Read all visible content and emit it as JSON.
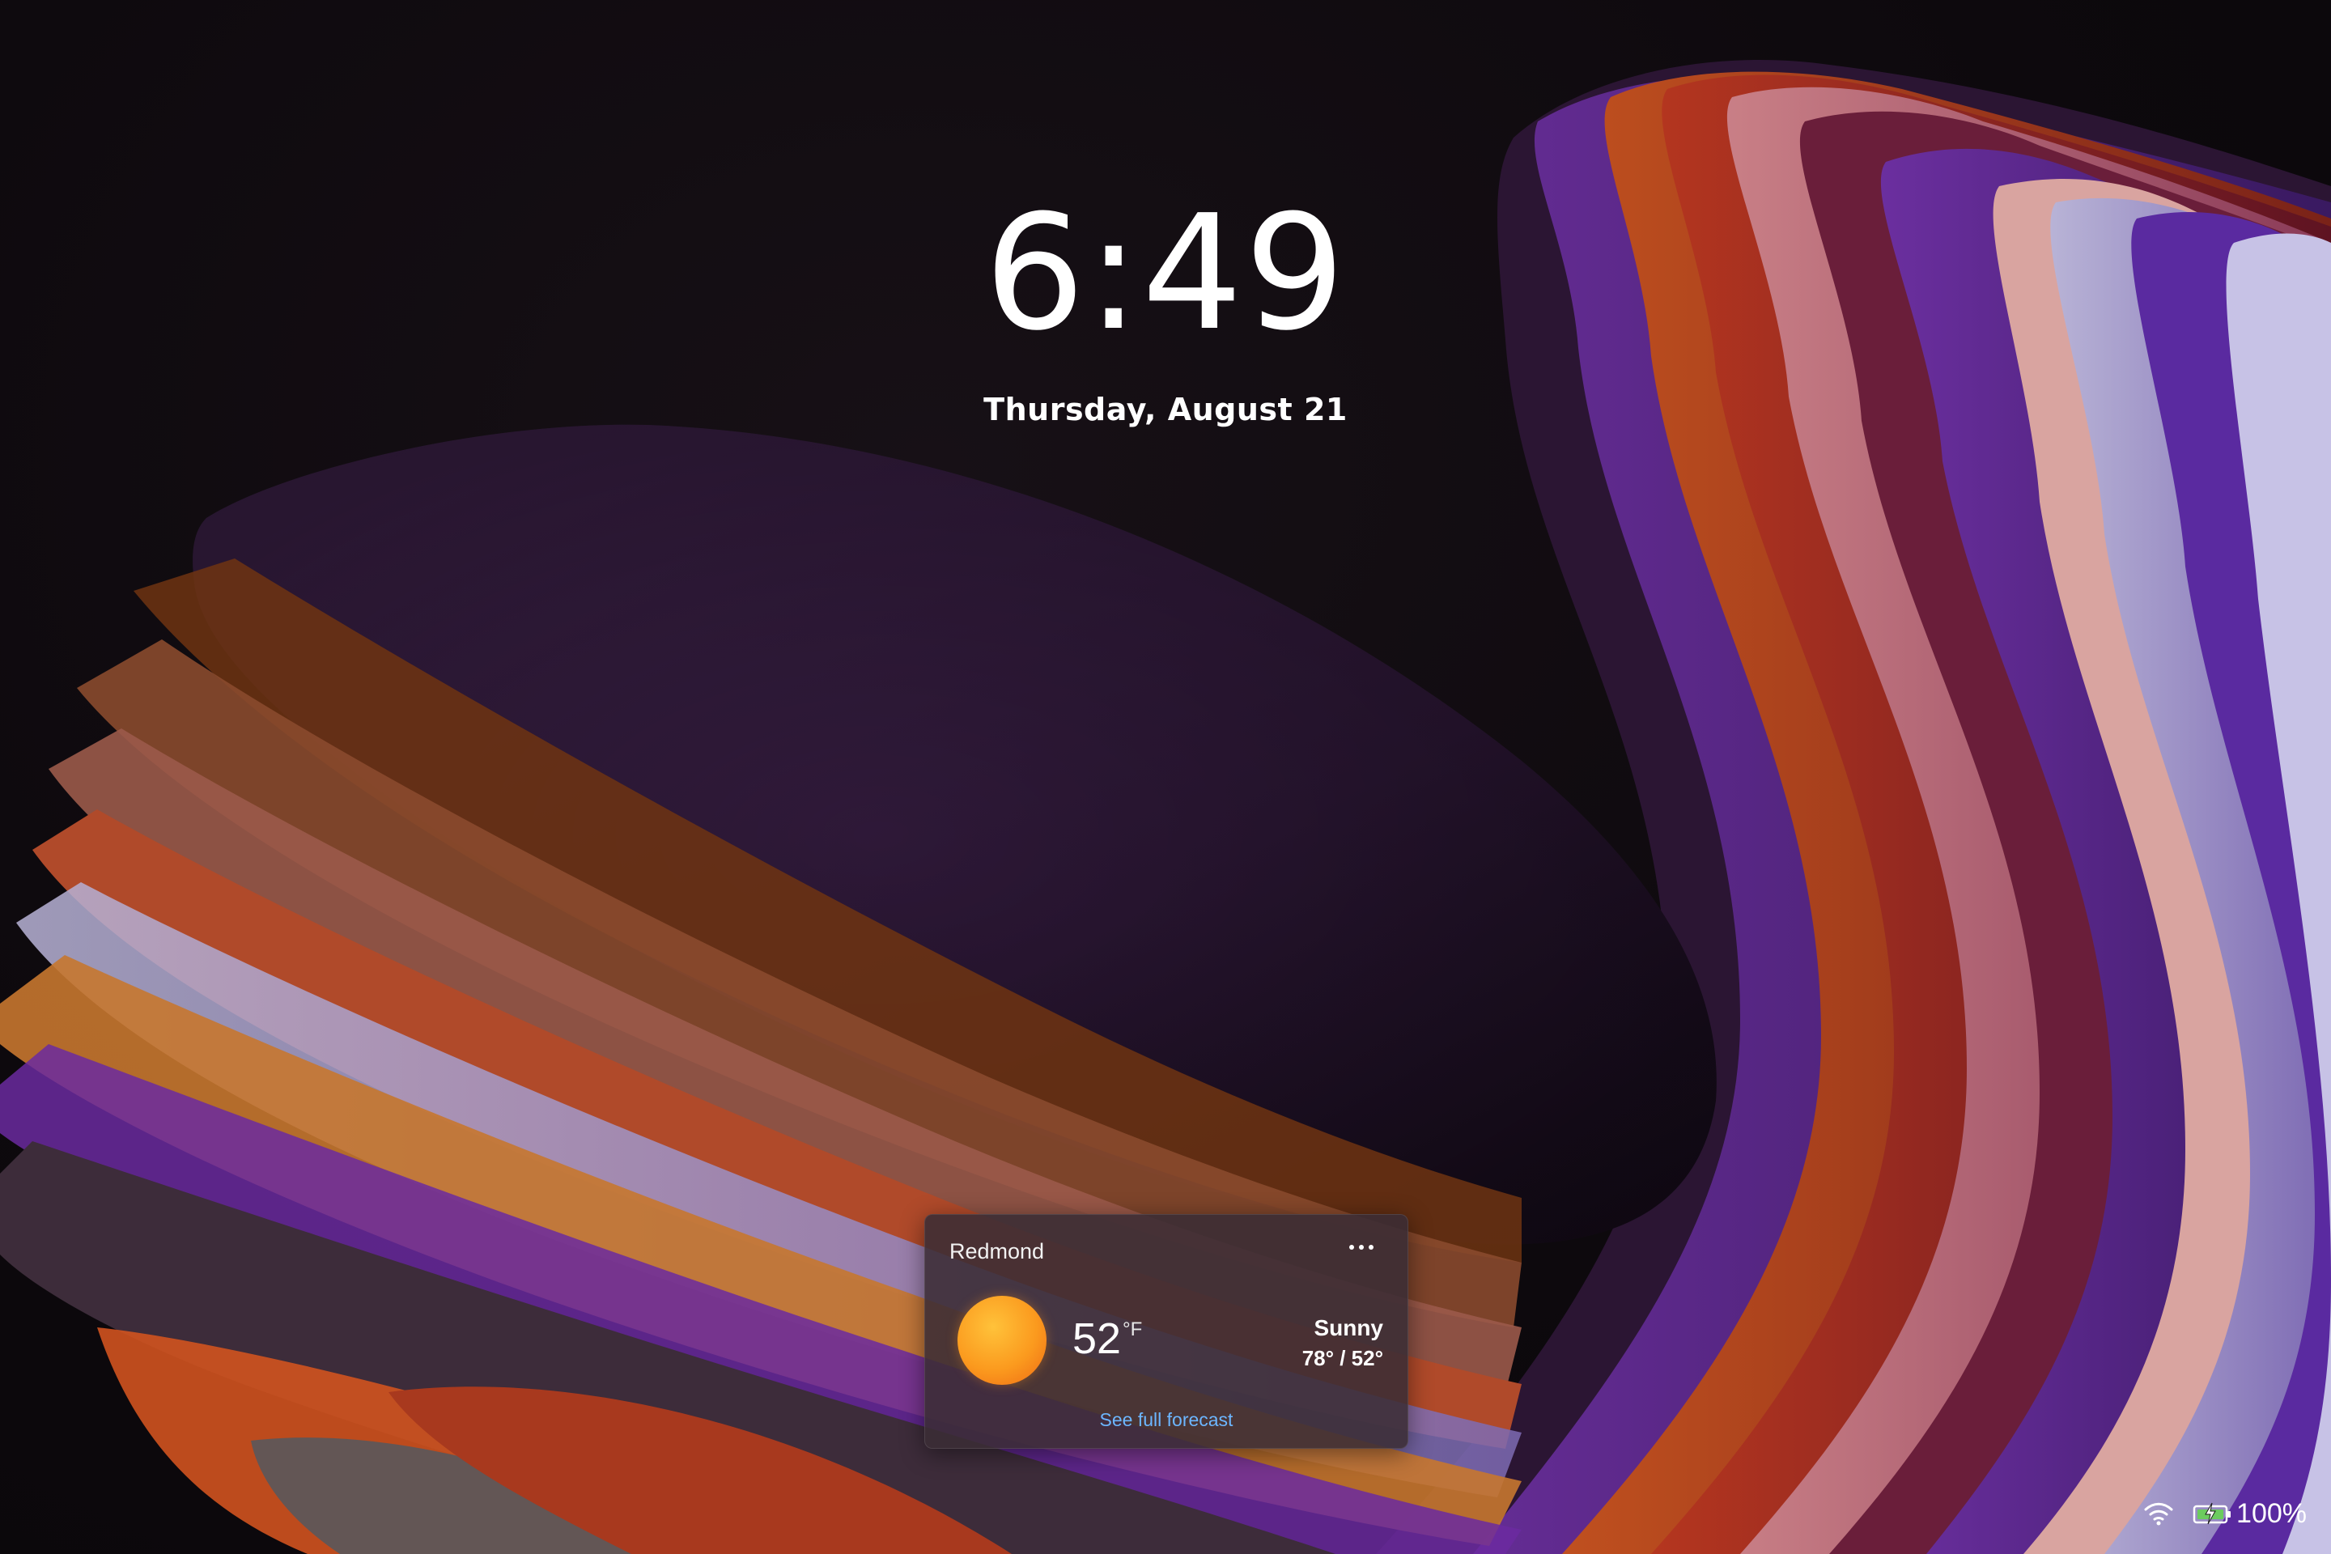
{
  "lockscreen": {
    "time": "6:49",
    "date": "Thursday, August 21"
  },
  "weather": {
    "location": "Redmond",
    "more_icon": "more-horizontal-icon",
    "condition_icon": "sun-icon",
    "temperature": "52",
    "unit": "°F",
    "condition": "Sunny",
    "high_low": "78° / 52°",
    "forecast_link": "See full forecast"
  },
  "status": {
    "network_icon": "wifi-icon",
    "battery_icon": "battery-charging-icon",
    "battery_percent": "100%"
  },
  "colors": {
    "link": "#6cb6ff",
    "sun": "#fb9a1e",
    "card_bg": "#3a2c34"
  }
}
